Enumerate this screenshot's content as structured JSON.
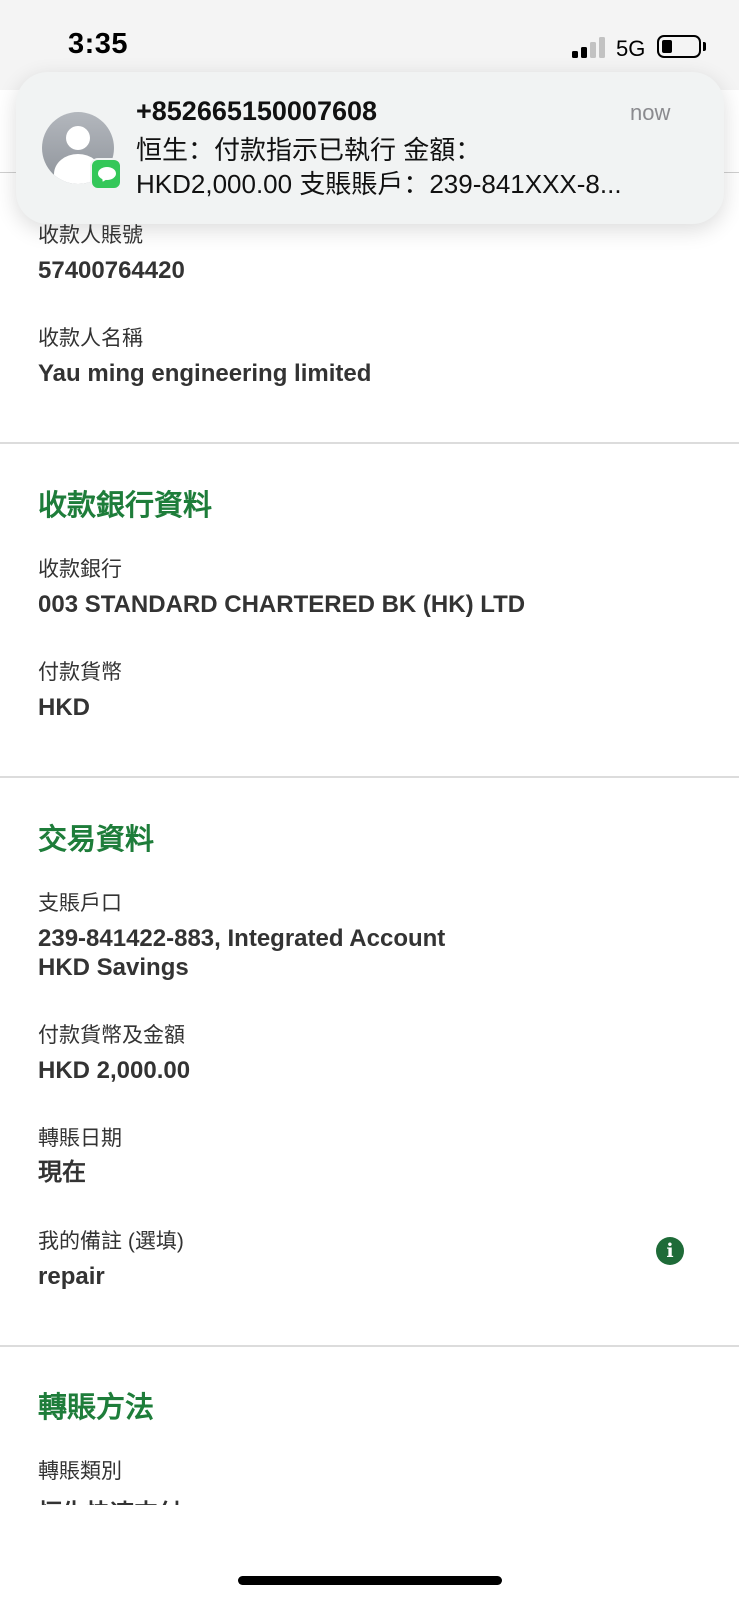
{
  "status_bar": {
    "time": "3:35",
    "network": "5G",
    "signal_bars": 2,
    "battery_level": 0.25
  },
  "notification": {
    "sender": "+852665150007608",
    "time": "now",
    "line1": "恒生：付款指示已執行 金額：",
    "line2": "HKD2,000.00 支賬賬戶：239-841XXX-8...",
    "app_icon": "messages-icon",
    "avatar_icon": "contact-avatar-icon"
  },
  "payee": {
    "account_label": "收款人賬號",
    "account_value": "57400764420",
    "name_label": "收款人名稱",
    "name_value": "Yau ming engineering limited"
  },
  "bank_section": {
    "title": "收款銀行資料",
    "bank_label": "收款銀行",
    "bank_value": "003 STANDARD CHARTERED BK (HK) LTD",
    "currency_label": "付款貨幣",
    "currency_value": "HKD"
  },
  "transaction_section": {
    "title": "交易資料",
    "debit_label": "支賬戶口",
    "debit_value_line1": "239-841422-883, Integrated Account",
    "debit_value_line2": "HKD Savings",
    "amount_label": "付款貨幣及金額",
    "amount_value": "HKD 2,000.00",
    "date_label": "轉賬日期",
    "date_value": "現在",
    "remark_label": "我的備註 (選填)",
    "remark_value": "repair",
    "info_icon": "info-icon",
    "info_glyph": "i"
  },
  "method_section": {
    "title": "轉賬方法",
    "type_label": "轉賬類別",
    "type_value_partial": "恒生快速支付"
  },
  "colors": {
    "accent_green": "#1e7d3a",
    "info_icon_green": "#1e6b38",
    "imessage_green": "#34c759"
  }
}
